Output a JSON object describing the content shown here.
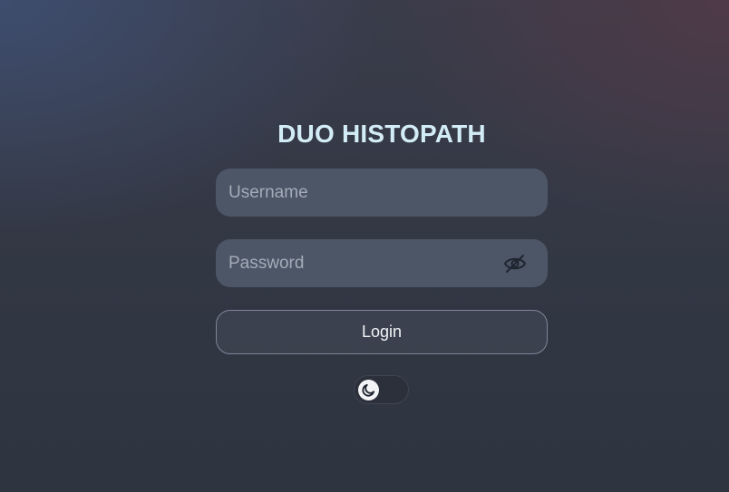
{
  "app": {
    "title": "DUO HISTOPATH"
  },
  "login_form": {
    "username_placeholder": "Username",
    "username_value": "",
    "password_placeholder": "Password",
    "password_value": "",
    "password_visibility_icon": "eye-off-icon",
    "login_label": "Login"
  },
  "theme_toggle": {
    "icon": "moon-icon",
    "state": "dark"
  },
  "colors": {
    "title": "#d3edf6",
    "field_background": "#4d5666",
    "placeholder": "#a3abb8",
    "button_border": "#7d8596"
  }
}
